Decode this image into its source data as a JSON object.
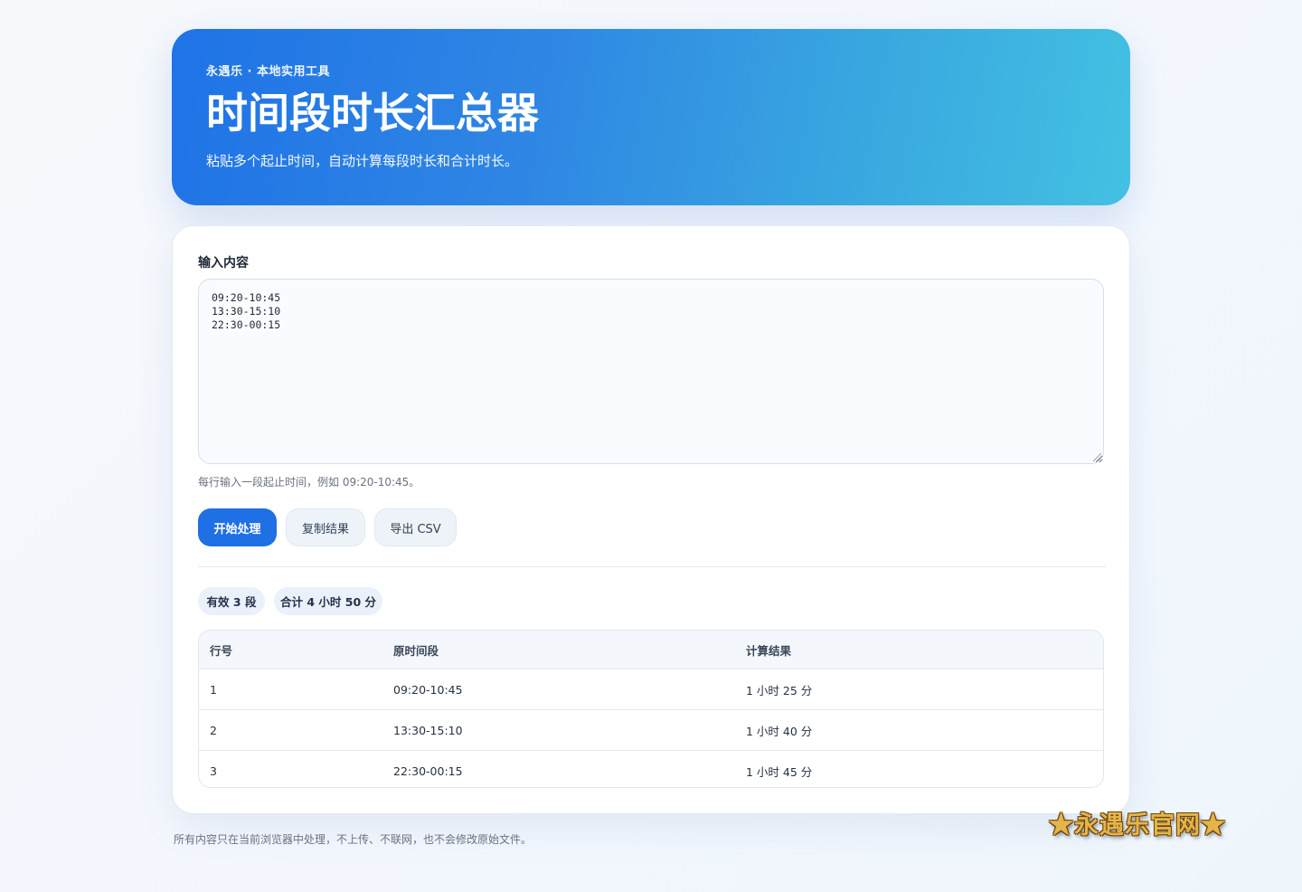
{
  "header": {
    "kicker": "永遇乐 · 本地实用工具",
    "title": "时间段时长汇总器",
    "subtitle": "粘贴多个起止时间，自动计算每段时长和合计时长。"
  },
  "input": {
    "label": "输入内容",
    "value": "09:20-10:45\n13:30-15:10\n22:30-00:15",
    "hint": "每行输入一段起止时间，例如 09:20-10:45。"
  },
  "actions": {
    "process_label": "开始处理",
    "copy_label": "复制结果",
    "export_label": "导出 CSV"
  },
  "summary": {
    "valid_count": "有效 3 段",
    "total": "合计 4 小时 50 分"
  },
  "table": {
    "columns": [
      "行号",
      "原时间段",
      "计算结果"
    ],
    "rows": [
      [
        "1",
        "09:20-10:45",
        "1 小时 25 分"
      ],
      [
        "2",
        "13:30-15:10",
        "1 小时 40 分"
      ],
      [
        "3",
        "22:30-00:15",
        "1 小时 45 分"
      ]
    ]
  },
  "footer": {
    "note": "所有内容只在当前浏览器中处理，不上传、不联网，也不会修改原始文件。"
  },
  "watermark": "★永遇乐官网★",
  "colors": {
    "primary": "#1f6fe5",
    "hero_start": "#1f73e6",
    "hero_end": "#43c1e2",
    "watermark_gold": "#e3b54a"
  }
}
